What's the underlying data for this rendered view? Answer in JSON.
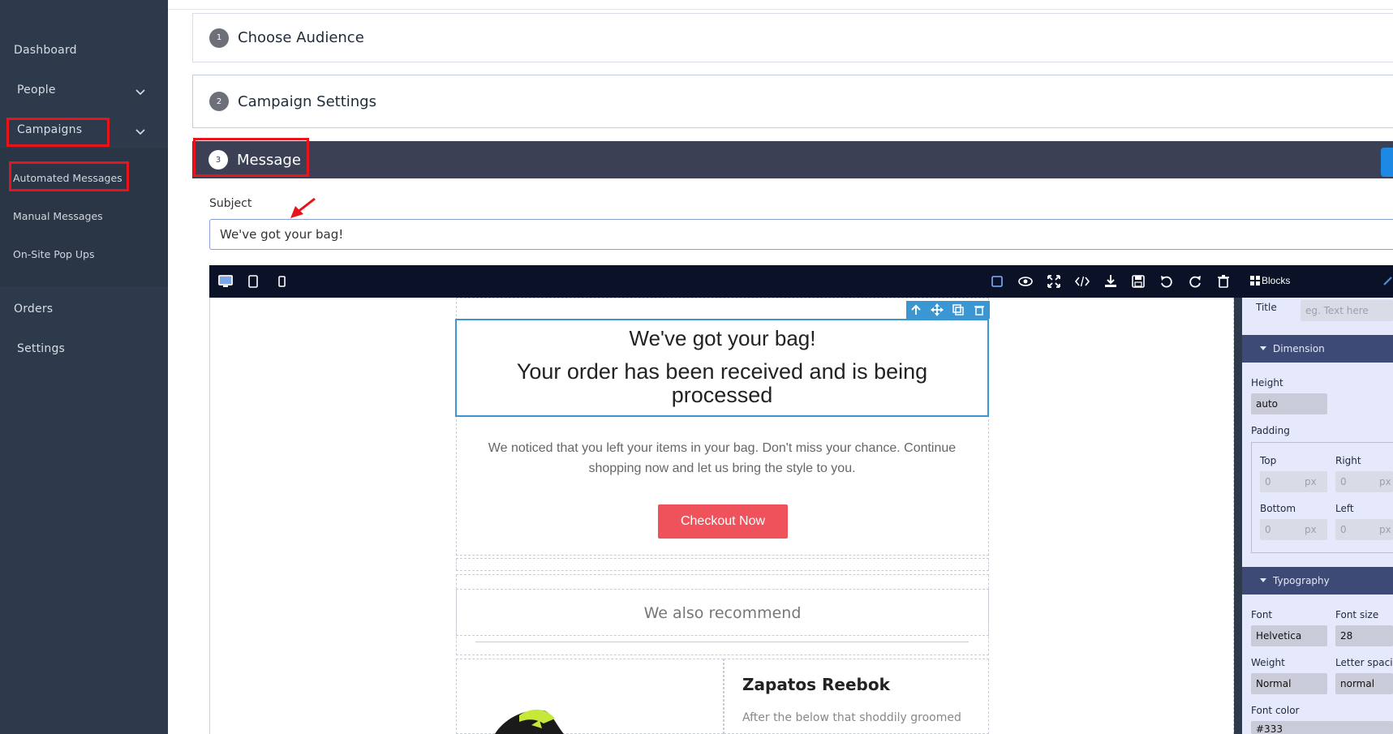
{
  "sidebar": {
    "items": [
      {
        "label": "Dashboard"
      },
      {
        "label": "People"
      },
      {
        "label": "Campaigns"
      },
      {
        "label": "Orders"
      },
      {
        "label": "Settings"
      }
    ],
    "sub_items": [
      {
        "label": "Automated Messages"
      },
      {
        "label": "Manual Messages"
      },
      {
        "label": "On-Site Pop Ups"
      }
    ]
  },
  "steps": [
    {
      "num": "1",
      "title": "Choose Audience"
    },
    {
      "num": "2",
      "title": "Campaign Settings"
    },
    {
      "num": "3",
      "title": "Message"
    }
  ],
  "subject": {
    "label": "Subject",
    "value": "We've got your bag!"
  },
  "editor": {
    "toolbar_left_icons": [
      "desktop-icon",
      "tablet-icon",
      "mobile-icon"
    ],
    "toolbar_right_icons": [
      "square-outline-icon",
      "eye-icon",
      "fullscreen-icon",
      "code-icon",
      "download-icon",
      "save-icon",
      "undo-icon",
      "redo-icon",
      "trash-icon"
    ],
    "blocks_label": "Blocks"
  },
  "email": {
    "heading": "We've got your bag!",
    "subheading": "Your order has been received and is being processed",
    "body": "We noticed that you left your items in your bag. Don't miss your chance. Continue shopping now and let us bring the style to you.",
    "cta": "Checkout Now",
    "recommend": "We also recommend",
    "product_title": "Zapatos Reebok",
    "product_desc": "After the below that shoddily groomed"
  },
  "style_panel": {
    "title_label": "Title",
    "title_placeholder": "eg. Text here",
    "dimension_header": "Dimension",
    "height_label": "Height",
    "height_value": "auto",
    "padding_label": "Padding",
    "top_label": "Top",
    "right_label": "Right",
    "bottom_label": "Bottom",
    "left_label": "Left",
    "pad_top": "0",
    "pad_right": "0",
    "pad_bottom": "0",
    "pad_left": "0",
    "unit": "px",
    "typography_header": "Typography",
    "font_label": "Font",
    "font_value": "Helvetica",
    "font_size_label": "Font size",
    "font_size_value": "28",
    "weight_label": "Weight",
    "weight_value": "Normal",
    "letter_spacing_label": "Letter spacing",
    "letter_spacing_value": "normal",
    "font_color_label": "Font color",
    "font_color_value": "#333"
  },
  "colors": {
    "sidebar_bg": "#2d3a4b",
    "active_step_bg": "#3b4055",
    "cta_bg": "#f0525b",
    "selection": "#3b97d3",
    "highlight": "#e8141b"
  }
}
